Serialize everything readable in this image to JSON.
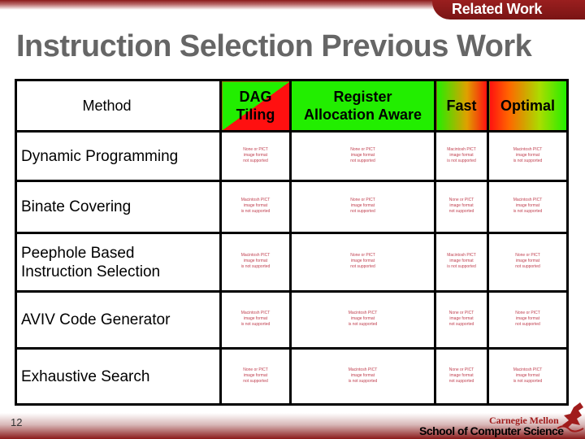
{
  "header": {
    "section_tab": "Related Work"
  },
  "slide": {
    "title": "Instruction Selection Previous Work",
    "page_number": "12"
  },
  "footer": {
    "university": "Carnegie Mellon",
    "school": "School of Computer Science"
  },
  "table": {
    "columns": [
      {
        "label": "Method"
      },
      {
        "label": "DAG Tiling",
        "line1": "DAG",
        "line2": "Tiling",
        "colors": [
          "#22ee00",
          "#ff1010"
        ]
      },
      {
        "label": "Register Allocation Aware",
        "line1": "Register",
        "line2": "Allocation Aware",
        "colors": [
          "#22ee00"
        ]
      },
      {
        "label": "Fast",
        "colors": [
          "#22ee00",
          "#ff1010"
        ]
      },
      {
        "label": "Optimal",
        "colors": [
          "#ff1010",
          "#22ee00"
        ]
      }
    ],
    "placeholders": {
      "mac": [
        "Macintosh PICT",
        "image format",
        "is not supported"
      ],
      "none": [
        "None or PICT",
        "image format",
        "not supported"
      ]
    },
    "rows": [
      {
        "method_line1": "Dynamic Programming",
        "method_line2": "",
        "cells": [
          "none",
          "none",
          "mac",
          "mac"
        ]
      },
      {
        "method_line1": "Binate Covering",
        "method_line2": "",
        "cells": [
          "mac",
          "none",
          "none",
          "mac"
        ]
      },
      {
        "method_line1": "Peephole Based",
        "method_line2": "Instruction Selection",
        "cells": [
          "mac",
          "none",
          "mac",
          "none"
        ]
      },
      {
        "method_line1": "AVIV Code Generator",
        "method_line2": "",
        "cells": [
          "mac",
          "mac",
          "none",
          "none"
        ]
      },
      {
        "method_line1": "Exhaustive Search",
        "method_line2": "",
        "cells": [
          "none",
          "mac",
          "none",
          "mac"
        ]
      }
    ]
  }
}
